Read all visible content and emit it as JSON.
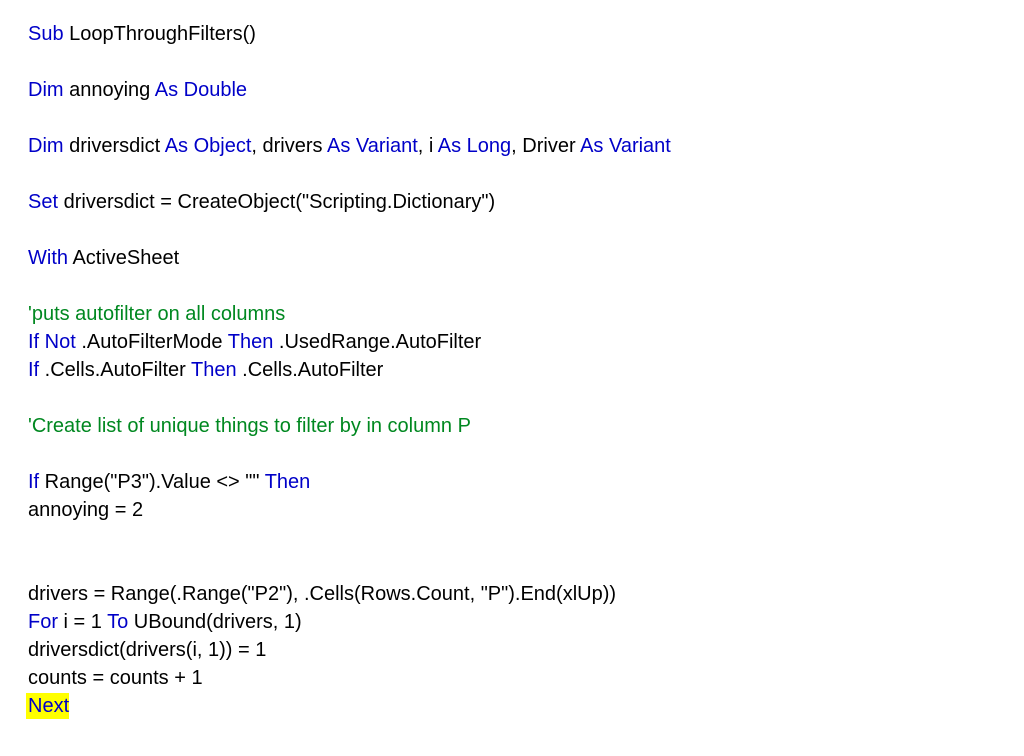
{
  "lines": [
    {
      "type": "code",
      "segments": [
        {
          "c": "kw",
          "t": "Sub"
        },
        {
          "c": "bk",
          "t": " LoopThroughFilters()"
        }
      ]
    },
    {
      "type": "gap"
    },
    {
      "type": "code",
      "segments": [
        {
          "c": "kw",
          "t": "Dim"
        },
        {
          "c": "bk",
          "t": " annoying "
        },
        {
          "c": "kw",
          "t": "As Double"
        }
      ]
    },
    {
      "type": "gap"
    },
    {
      "type": "code",
      "segments": [
        {
          "c": "kw",
          "t": "Dim"
        },
        {
          "c": "bk",
          "t": " driversdict "
        },
        {
          "c": "kw",
          "t": "As Object"
        },
        {
          "c": "bk",
          "t": ", drivers "
        },
        {
          "c": "kw",
          "t": "As Variant"
        },
        {
          "c": "bk",
          "t": ", i "
        },
        {
          "c": "kw",
          "t": "As Long"
        },
        {
          "c": "bk",
          "t": ", Driver "
        },
        {
          "c": "kw",
          "t": "As Variant"
        }
      ]
    },
    {
      "type": "gap"
    },
    {
      "type": "code",
      "segments": [
        {
          "c": "kw",
          "t": "Set"
        },
        {
          "c": "bk",
          "t": " driversdict = CreateObject(\"Scripting.Dictionary\")"
        }
      ]
    },
    {
      "type": "gap"
    },
    {
      "type": "code",
      "segments": [
        {
          "c": "kw",
          "t": "With"
        },
        {
          "c": "bk",
          "t": " ActiveSheet"
        }
      ]
    },
    {
      "type": "gap"
    },
    {
      "type": "code",
      "segments": [
        {
          "c": "cm",
          "t": "'puts autofilter on all columns"
        }
      ]
    },
    {
      "type": "code",
      "segments": [
        {
          "c": "kw",
          "t": "If Not"
        },
        {
          "c": "bk",
          "t": " .AutoFilterMode "
        },
        {
          "c": "kw",
          "t": "Then"
        },
        {
          "c": "bk",
          "t": " .UsedRange.AutoFilter"
        }
      ]
    },
    {
      "type": "code",
      "segments": [
        {
          "c": "kw",
          "t": "If"
        },
        {
          "c": "bk",
          "t": " .Cells.AutoFilter "
        },
        {
          "c": "kw",
          "t": "Then"
        },
        {
          "c": "bk",
          "t": " .Cells.AutoFilter"
        }
      ]
    },
    {
      "type": "gap"
    },
    {
      "type": "code",
      "segments": [
        {
          "c": "cm",
          "t": "'Create list of unique things to filter by in column P"
        }
      ]
    },
    {
      "type": "gap"
    },
    {
      "type": "code",
      "segments": [
        {
          "c": "kw",
          "t": "If"
        },
        {
          "c": "bk",
          "t": " Range(\"P3\").Value <> \"\" "
        },
        {
          "c": "kw",
          "t": "Then"
        }
      ]
    },
    {
      "type": "code",
      "segments": [
        {
          "c": "bk",
          "t": "annoying = 2"
        }
      ]
    },
    {
      "type": "gap"
    },
    {
      "type": "gap"
    },
    {
      "type": "code",
      "segments": [
        {
          "c": "bk",
          "t": "drivers = Range(.Range(\"P2\"), .Cells(Rows.Count, \"P\").End(xlUp))"
        }
      ]
    },
    {
      "type": "code",
      "segments": [
        {
          "c": "kw",
          "t": "For"
        },
        {
          "c": "bk",
          "t": " i = 1 "
        },
        {
          "c": "kw",
          "t": "To"
        },
        {
          "c": "bk",
          "t": " UBound(drivers, 1)"
        }
      ]
    },
    {
      "type": "code",
      "segments": [
        {
          "c": "bk",
          "t": "driversdict(drivers(i, 1)) = 1"
        }
      ]
    },
    {
      "type": "code",
      "segments": [
        {
          "c": "bk",
          "t": "counts = counts + 1"
        }
      ]
    },
    {
      "type": "code",
      "highlight": true,
      "segments": [
        {
          "c": "kw",
          "t": "Next"
        }
      ]
    }
  ]
}
